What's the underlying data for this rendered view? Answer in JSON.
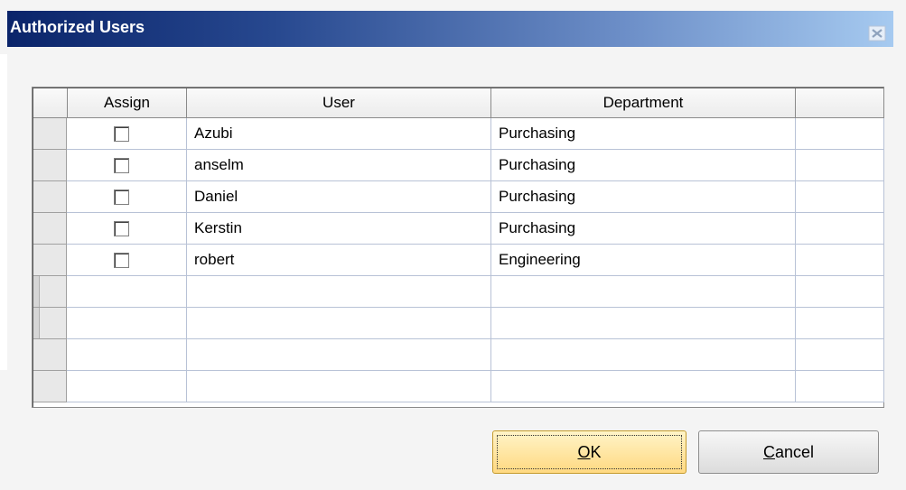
{
  "dialog": {
    "title": "Authorized Users",
    "close_icon": "close-icon"
  },
  "grid": {
    "columns": [
      "Assign",
      "User",
      "Department"
    ],
    "rows": [
      {
        "assigned": false,
        "user": "Azubi",
        "department": "Purchasing"
      },
      {
        "assigned": false,
        "user": "anselm",
        "department": "Purchasing"
      },
      {
        "assigned": false,
        "user": "Daniel",
        "department": "Purchasing"
      },
      {
        "assigned": false,
        "user": "Kerstin",
        "department": "Purchasing"
      },
      {
        "assigned": false,
        "user": "robert",
        "department": "Engineering"
      }
    ],
    "empty_rows": 4
  },
  "buttons": {
    "ok": {
      "mnemonic": "O",
      "rest": "K"
    },
    "cancel": {
      "mnemonic": "C",
      "rest": "ancel"
    }
  },
  "colors": {
    "title_gradient_start": "#0a246a",
    "title_gradient_end": "#a6caf0",
    "ok_button": "#ffd981"
  }
}
